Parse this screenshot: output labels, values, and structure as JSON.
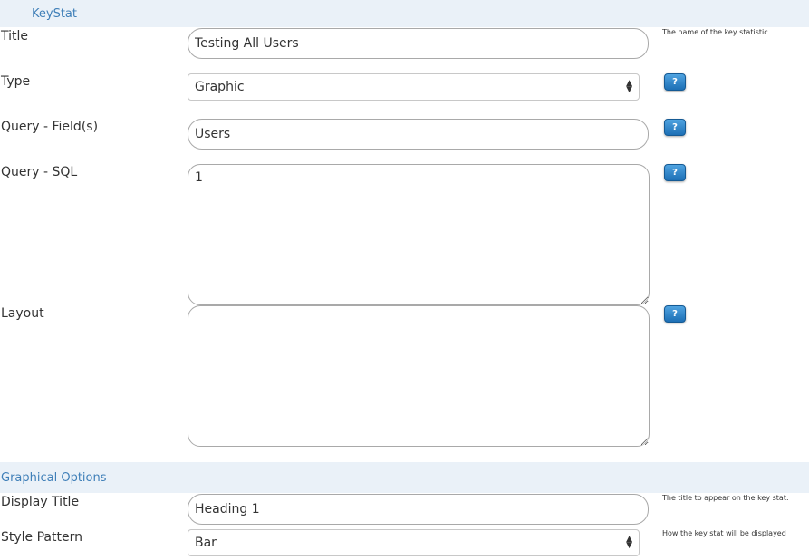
{
  "keystat_section": {
    "title": "KeyStat",
    "fields": {
      "title": {
        "label": "Title",
        "value": "Testing All Users",
        "hint": "The name of the key statistic."
      },
      "type": {
        "label": "Type",
        "value": "Graphic",
        "help": "?"
      },
      "query_fields": {
        "label": "Query - Field(s)",
        "value": "Users",
        "help": "?"
      },
      "query_sql": {
        "label": "Query - SQL",
        "value": "1",
        "help": "?"
      },
      "layout": {
        "label": "Layout",
        "value": "",
        "help": "?"
      }
    }
  },
  "graphical_section": {
    "title": "Graphical Options",
    "fields": {
      "display_title": {
        "label": "Display Title",
        "value": "Heading 1",
        "hint": "The title to appear on the key stat."
      },
      "style_pattern": {
        "label": "Style Pattern",
        "value": "Bar",
        "hint": "How the key stat will be displayed"
      }
    }
  },
  "colors": {
    "header_bg": "#eaf1f8",
    "header_text": "#3f7fb8",
    "help_button": "#2a7fc5"
  },
  "icons": {
    "help": "question-mark-icon",
    "select_arrows": "up-down-chevron-icon"
  }
}
